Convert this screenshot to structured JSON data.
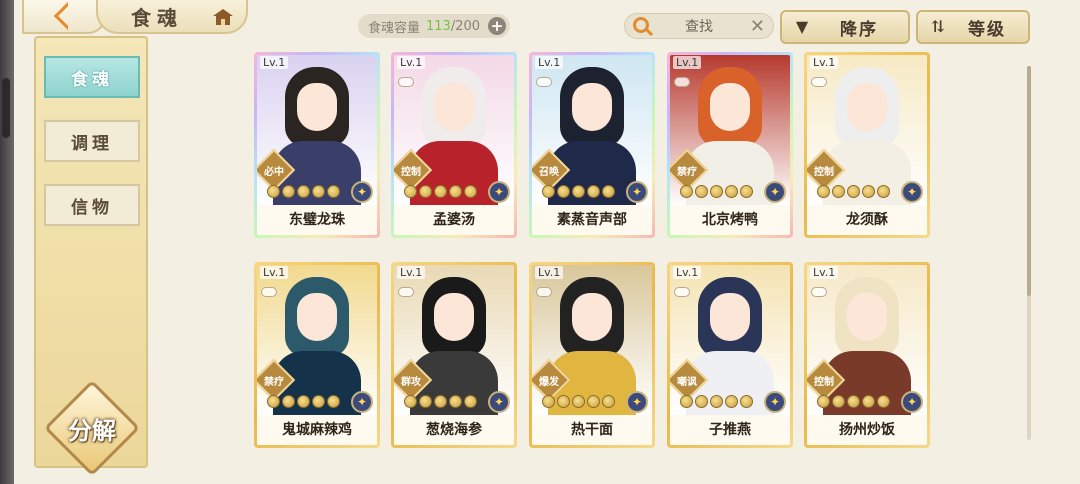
{
  "header": {
    "title": "食魂",
    "capacity_label": "食魂容量",
    "capacity_current": "113",
    "capacity_max": "/200",
    "search_placeholder": "查找",
    "sort_order_label": "降序",
    "sort_field_label": "等级"
  },
  "sidebar": {
    "items": [
      {
        "label": "食魂",
        "active": true
      },
      {
        "label": "调理",
        "active": false
      },
      {
        "label": "信物",
        "active": false
      }
    ],
    "decompose_label": "分解"
  },
  "cards": [
    {
      "level": "Lv.1",
      "name": "东璧龙珠",
      "role": "必中",
      "frame": "rainbow",
      "hair": "#2a2520",
      "body": "#3a3f6a",
      "bg": "#d9d2f0"
    },
    {
      "level": "Lv.1",
      "name": "孟婆汤",
      "role": "控制",
      "frame": "rainbow",
      "hair": "#f0ecec",
      "body": "#b8222a",
      "bg": "#f3d9e6"
    },
    {
      "level": "Lv.1",
      "name": "素蒸音声部",
      "role": "召唤",
      "frame": "rainbow",
      "hair": "#1c2230",
      "body": "#1f2a4a",
      "bg": "#cfe6f2"
    },
    {
      "level": "Lv.1",
      "name": "北京烤鸭",
      "role": "禁疗",
      "frame": "rainbow",
      "hair": "#d9622a",
      "body": "#f2efe6",
      "bg": "#b63a2e"
    },
    {
      "level": "Lv.1",
      "name": "龙须酥",
      "role": "控制",
      "frame": "gold",
      "hair": "#eeeeee",
      "body": "#f3efe4",
      "bg": "#f6e9c4"
    },
    {
      "level": "Lv.1",
      "name": "鬼城麻辣鸡",
      "role": "禁疗",
      "frame": "gold",
      "hair": "#2c5a6a",
      "body": "#14324a",
      "bg": "#f1d98e"
    },
    {
      "level": "Lv.1",
      "name": "葱烧海参",
      "role": "群攻",
      "frame": "gold",
      "hair": "#1a1a1a",
      "body": "#3a3a3a",
      "bg": "#e9d9b4"
    },
    {
      "level": "Lv.1",
      "name": "热干面",
      "role": "爆发",
      "frame": "gold",
      "hair": "#222222",
      "body": "#e1b640",
      "bg": "#d9c79a"
    },
    {
      "level": "Lv.1",
      "name": "子推燕",
      "role": "嘲讽",
      "frame": "gold",
      "hair": "#2a3558",
      "body": "#eef0f4",
      "bg": "#f4e3b2"
    },
    {
      "level": "Lv.1",
      "name": "扬州炒饭",
      "role": "控制",
      "frame": "gold",
      "hair": "#efe3c4",
      "body": "#7a3a2a",
      "bg": "#f6e9c8"
    }
  ]
}
